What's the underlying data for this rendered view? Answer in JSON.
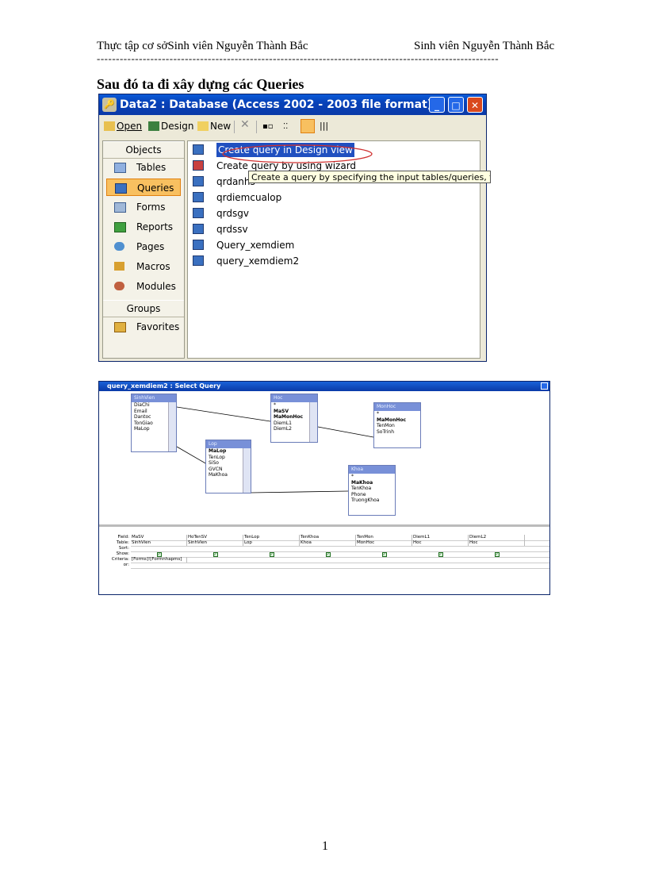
{
  "header": {
    "left": "Thực tập cơ sởSinh viên Nguyễn Thành Bắc",
    "right": "Sinh viên Nguyễn Thành Bắc",
    "rule": "---------------------------------------------------------------------------------------------------------"
  },
  "heading": "Sau đó ta đi xây dựng các Queries",
  "db_window": {
    "title": "Data2 : Database (Access 2002 - 2003 file format)",
    "toolbar": {
      "open": "Open",
      "design": "Design",
      "new": "New"
    },
    "objects_header": "Objects",
    "objects": [
      "Tables",
      "Queries",
      "Forms",
      "Reports",
      "Pages",
      "Macros",
      "Modules"
    ],
    "groups_header": "Groups",
    "groups": [
      "Favorites"
    ],
    "queries": [
      "Create query in Design view",
      "Create query by using wizard",
      "qrdanhs",
      "qrdiemcualop",
      "qrdsgv",
      "qrdssv",
      "Query_xemdiem",
      "query_xemdiem2"
    ],
    "tooltip": "Create a query by specifying the input tables/queries, field n"
  },
  "query_window": {
    "title": "query_xemdiem2 : Select Query",
    "tables": [
      {
        "name": "SinhVien",
        "fields": [
          "DiaChi",
          "Email",
          "Dantoc",
          "TonGiao",
          "MaLop"
        ]
      },
      {
        "name": "Hoc",
        "fields": [
          "*",
          "MaSV",
          "MaMonHoc",
          "DiemL1",
          "DiemL2"
        ]
      },
      {
        "name": "MonHoc",
        "fields": [
          "*",
          "MaMonHoc",
          "TenMon",
          "SoTrinh"
        ]
      },
      {
        "name": "Lop",
        "fields": [
          "MaLop",
          "TenLop",
          "SiSo",
          "GVCN",
          "MaKhoa"
        ]
      },
      {
        "name": "Khoa",
        "fields": [
          "*",
          "MaKhoa",
          "TenKhoa",
          "Phone",
          "TruongKhoa"
        ]
      }
    ],
    "grid_labels": [
      "Field:",
      "Table:",
      "Sort:",
      "Show:",
      "Criteria:",
      "or:"
    ],
    "columns": [
      {
        "field": "MaSV",
        "table": "SinhVien",
        "criteria": "[Forms]![Formnhapms]"
      },
      {
        "field": "HoTenSV",
        "table": "SinhVien",
        "criteria": ""
      },
      {
        "field": "TenLop",
        "table": "Lop",
        "criteria": ""
      },
      {
        "field": "TenKhoa",
        "table": "Khoa",
        "criteria": ""
      },
      {
        "field": "TenMon",
        "table": "MonHoc",
        "criteria": ""
      },
      {
        "field": "DiemL1",
        "table": "Hoc",
        "criteria": ""
      },
      {
        "field": "DiemL2",
        "table": "Hoc",
        "criteria": ""
      }
    ]
  },
  "page_number": "1"
}
